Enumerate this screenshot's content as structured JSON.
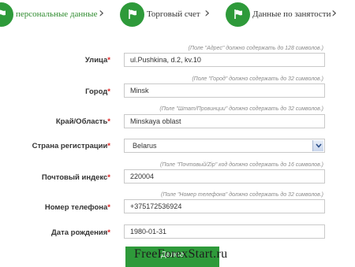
{
  "steps": [
    {
      "label": "персональные данные",
      "icon": "flag-icon"
    },
    {
      "label": "Торговый счет",
      "icon": "flag-icon"
    },
    {
      "label": "Данные по занятости",
      "icon": "flag-icon"
    }
  ],
  "form": {
    "street": {
      "hint": "(Поле \"Адрес\" должно содержать до 128 символов.)",
      "label": "Улица",
      "required_mark": "*",
      "value": "ul.Pushkina, d.2, kv.10"
    },
    "city": {
      "hint": "(Поле \"Город\" должно содержать до 32 символов.)",
      "label": "Город",
      "required_mark": "*",
      "value": "Minsk"
    },
    "region": {
      "hint": "(Поле \"Штат/Провинции\" должно содержать до 32 символов.)",
      "label": "Край/Область",
      "required_mark": "*",
      "value": "Minskaya oblast"
    },
    "country": {
      "label": "Страна регистрации",
      "required_mark": "*",
      "value": "Belarus"
    },
    "postal": {
      "hint": "(Поле \"Почтовый/Zip\" код должно содержать до 16 символов.)",
      "label": "Почтовый индекс",
      "required_mark": "*",
      "value": "220004"
    },
    "phone": {
      "hint": "(Поле \"Номер телефона\" должно содержать до 32 символов.)",
      "label": "Номер телефона",
      "required_mark": "*",
      "value": "+375172536924"
    },
    "birthdate": {
      "label": "Дата рождения",
      "required_mark": "*",
      "value": "1980-01-31"
    }
  },
  "submit_label": "Далее",
  "watermark": "FreeForexStart.ru",
  "colors": {
    "accent": "#2e9a3a",
    "required": "#dd2222"
  }
}
